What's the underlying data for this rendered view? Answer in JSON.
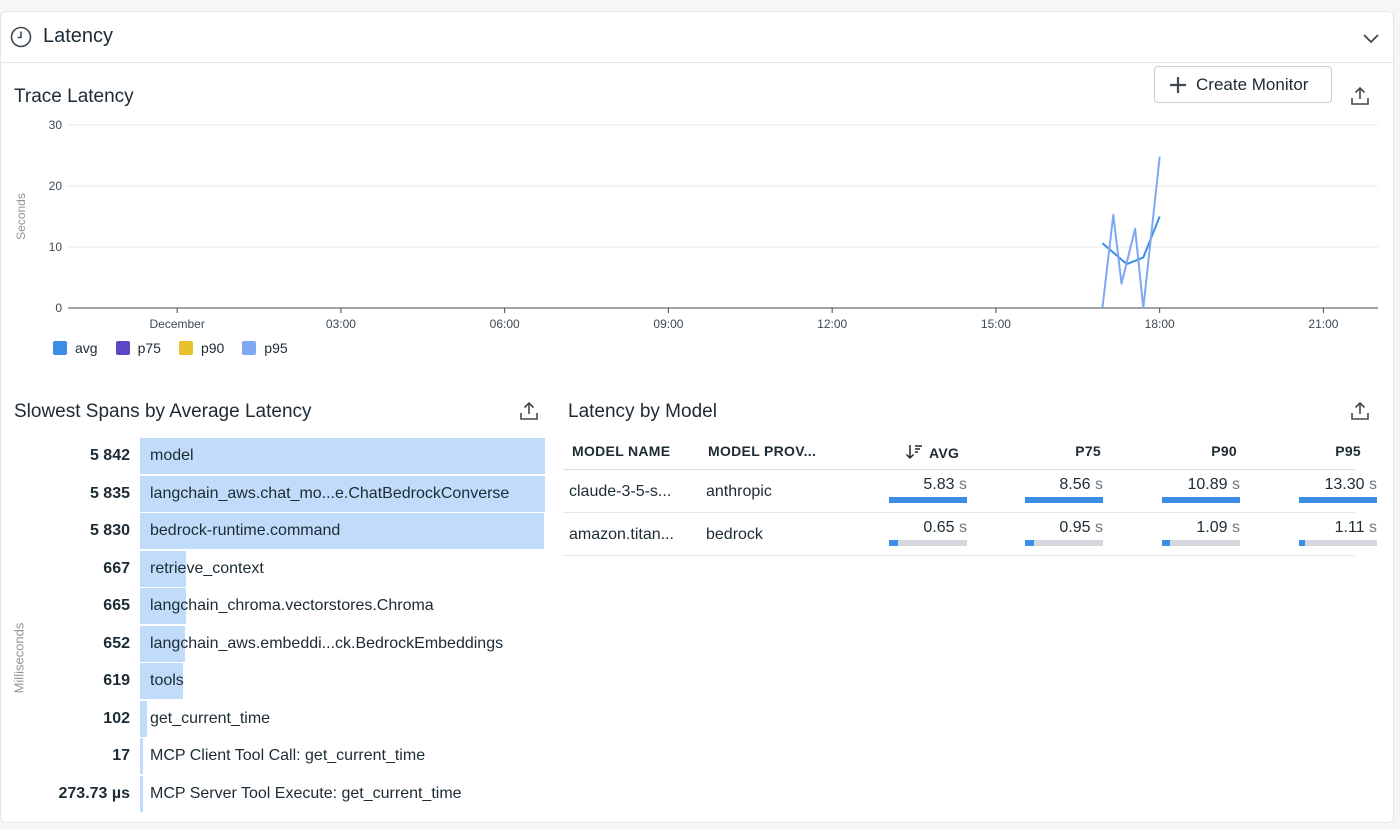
{
  "panel": {
    "title": "Latency"
  },
  "trace": {
    "title": "Trace Latency",
    "create_monitor_label": "Create Monitor",
    "legend": [
      {
        "label": "avg",
        "color": "#3d8ee6"
      },
      {
        "label": "p75",
        "color": "#5c48c4"
      },
      {
        "label": "p90",
        "color": "#e8c12e"
      },
      {
        "label": "p95",
        "color": "#7fa8f2"
      }
    ]
  },
  "chart_data": {
    "type": "line",
    "ylabel": "Seconds",
    "ylim": [
      0,
      30
    ],
    "yticks": [
      0,
      10,
      20,
      30
    ],
    "x_ticks": [
      "December",
      "03:00",
      "06:00",
      "09:00",
      "12:00",
      "15:00",
      "18:00",
      "21:00"
    ],
    "grid": true,
    "legend_placement": "bottom-left",
    "series": [
      {
        "name": "avg",
        "points": [
          [
            16.95,
            10.6
          ],
          [
            17.4,
            7.2
          ],
          [
            17.7,
            8.3
          ],
          [
            18.0,
            15.0
          ]
        ]
      },
      {
        "name": "p95",
        "points": [
          [
            16.95,
            0
          ],
          [
            17.15,
            15.3
          ],
          [
            17.3,
            4.0
          ],
          [
            17.55,
            13.0
          ],
          [
            17.7,
            0
          ],
          [
            18.0,
            24.8
          ]
        ]
      }
    ]
  },
  "spans": {
    "title": "Slowest Spans by Average Latency",
    "axis_label": "Milliseconds",
    "items": [
      {
        "value": "5 842",
        "ms": 5842,
        "name": "model"
      },
      {
        "value": "5 835",
        "ms": 5835,
        "name": "langchain_aws.chat_mo...e.ChatBedrockConverse"
      },
      {
        "value": "5 830",
        "ms": 5830,
        "name": "bedrock-runtime.command"
      },
      {
        "value": "667",
        "ms": 667,
        "name": "retrieve_context"
      },
      {
        "value": "665",
        "ms": 665,
        "name": "langchain_chroma.vectorstores.Chroma"
      },
      {
        "value": "652",
        "ms": 652,
        "name": "langchain_aws.embeddi...ck.BedrockEmbeddings"
      },
      {
        "value": "619",
        "ms": 619,
        "name": "tools"
      },
      {
        "value": "102",
        "ms": 102,
        "name": "get_current_time"
      },
      {
        "value": "17",
        "ms": 17,
        "name": "MCP Client Tool Call: get_current_time"
      },
      {
        "value": "273.73 µs",
        "ms": 0.27,
        "name": "MCP Server Tool Execute: get_current_time"
      }
    ]
  },
  "model": {
    "title": "Latency by Model",
    "columns": {
      "name": "MODEL NAME",
      "provider": "MODEL PROV...",
      "avg": "AVG",
      "p75": "P75",
      "p90": "P90",
      "p95": "P95"
    },
    "unit": "s",
    "rows": [
      {
        "name": "claude-3-5-s...",
        "provider": "anthropic",
        "avg": {
          "text": "5.83",
          "frac": 1.0
        },
        "p75": {
          "text": "8.56",
          "frac": 1.0
        },
        "p90": {
          "text": "10.89",
          "frac": 1.0
        },
        "p95": {
          "text": "13.30",
          "frac": 1.0
        }
      },
      {
        "name": "amazon.titan...",
        "provider": "bedrock",
        "avg": {
          "text": "0.65",
          "frac": 0.11
        },
        "p75": {
          "text": "0.95",
          "frac": 0.11
        },
        "p90": {
          "text": "1.09",
          "frac": 0.1
        },
        "p95": {
          "text": "1.11",
          "frac": 0.08
        }
      }
    ]
  }
}
